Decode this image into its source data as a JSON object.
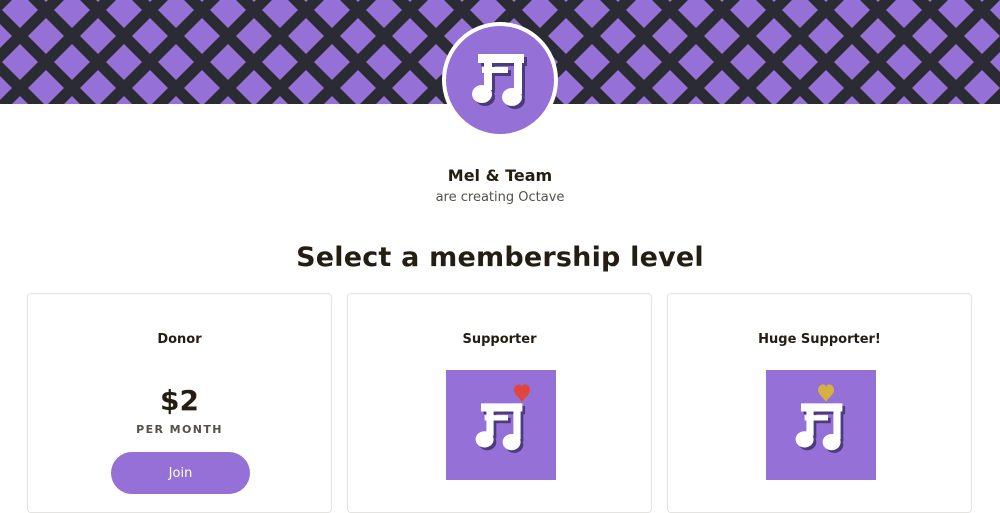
{
  "creator": {
    "name": "Mel & Team",
    "subtitle": "are creating Octave"
  },
  "page": {
    "title": "Select a membership level"
  },
  "colors": {
    "brand": "#9570d6",
    "banner_dark": "#2b2b33",
    "heart_red": "#e0463c",
    "heart_gold": "#d6b142"
  },
  "icons": {
    "avatar": "music-note-icon",
    "tier_supporter": "music-note-heart-icon",
    "tier_huge": "music-note-heart-icon"
  },
  "tiers": [
    {
      "name": "Donor",
      "price": "$2",
      "period": "PER MONTH",
      "button": "Join"
    },
    {
      "name": "Supporter"
    },
    {
      "name": "Huge Supporter!"
    }
  ]
}
